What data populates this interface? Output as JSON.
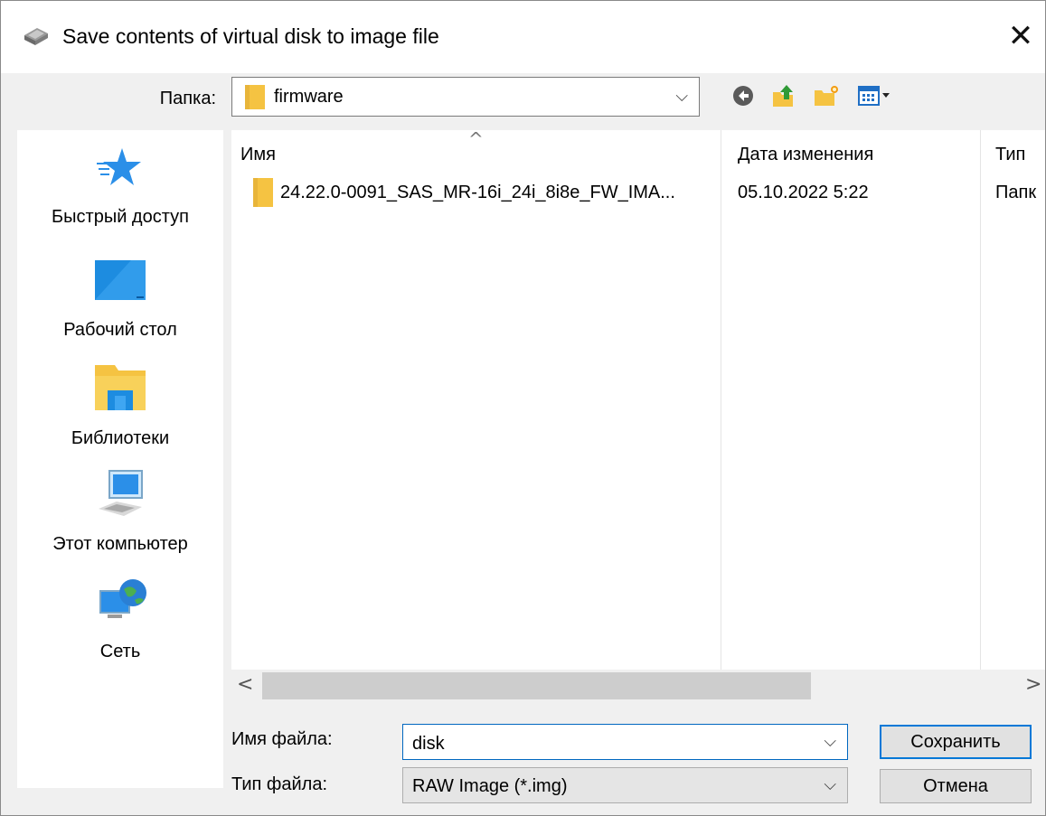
{
  "window": {
    "title": "Save contents of virtual disk to image file",
    "icon": "disk-drive-icon",
    "close": "✕"
  },
  "toolbar": {
    "folder_label": "Папка:",
    "current_folder": "firmware",
    "buttons": [
      "back-icon",
      "up-folder-icon",
      "new-folder-icon",
      "view-menu-icon"
    ]
  },
  "places": [
    {
      "label": "Быстрый доступ",
      "icon": "quick-access-star-icon"
    },
    {
      "label": "Рабочий стол",
      "icon": "desktop-icon"
    },
    {
      "label": "Библиотеки",
      "icon": "libraries-icon"
    },
    {
      "label": "Этот компьютер",
      "icon": "computer-icon"
    },
    {
      "label": "Сеть",
      "icon": "network-icon"
    }
  ],
  "file_list": {
    "columns": [
      "Имя",
      "Дата изменения",
      "Тип"
    ],
    "rows": [
      {
        "name": "24.22.0-0091_SAS_MR-16i_24i_8i8e_FW_IMA...",
        "date": "05.10.2022 5:22",
        "type": "Папк"
      }
    ]
  },
  "form": {
    "filename_label": "Имя файла:",
    "filename_value": "disk",
    "filetype_label": "Тип файла:",
    "filetype_value": "RAW Image (*.img)",
    "save_label": "Сохранить",
    "cancel_label": "Отмена"
  },
  "colors": {
    "accent": "#0078d7",
    "folder": "#f5c342"
  }
}
